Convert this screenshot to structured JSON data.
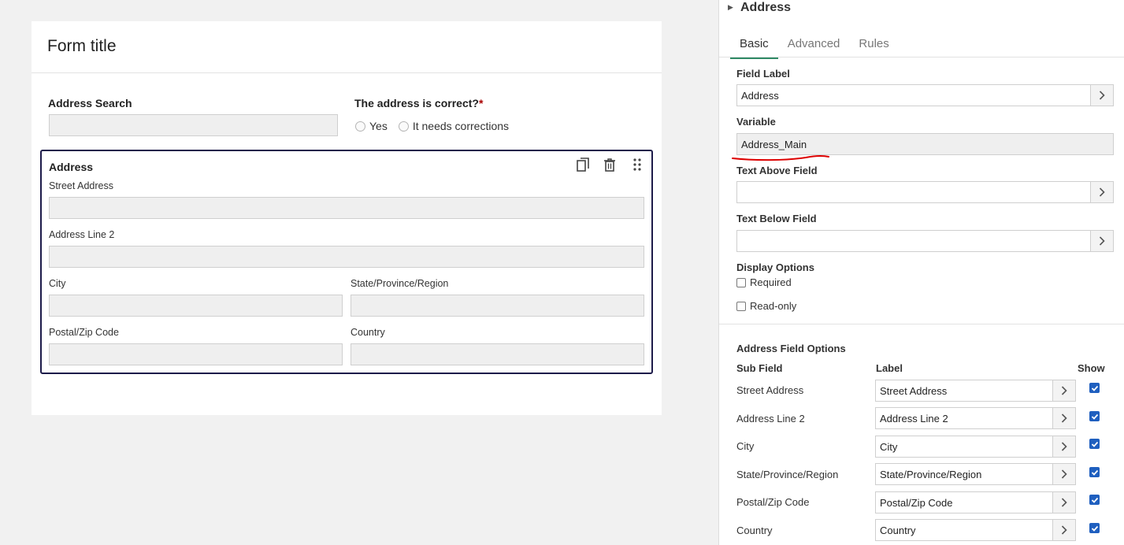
{
  "form": {
    "title": "Form title",
    "address_search_label": "Address Search",
    "correct_question": "The address is correct?",
    "required_marker": "*",
    "radio_yes": "Yes",
    "radio_corrections": "It needs corrections",
    "address_block": {
      "title": "Address",
      "street_label": "Street Address",
      "line2_label": "Address Line 2",
      "city_label": "City",
      "state_label": "State/Province/Region",
      "postal_label": "Postal/Zip Code",
      "country_label": "Country"
    }
  },
  "panel": {
    "title": "Address",
    "tabs": [
      {
        "label": "Basic",
        "active": true
      },
      {
        "label": "Advanced",
        "active": false
      },
      {
        "label": "Rules",
        "active": false
      }
    ],
    "field_label_title": "Field Label",
    "field_label_value": "Address",
    "variable_title": "Variable",
    "variable_value": "Address_Main",
    "text_above_title": "Text Above Field",
    "text_below_title": "Text Below Field",
    "display_options_title": "Display Options",
    "required_label": "Required",
    "readonly_label": "Read-only",
    "address_options_title": "Address Field Options",
    "col_subfield": "Sub Field",
    "col_label": "Label",
    "col_show": "Show",
    "subfields": [
      {
        "name": "Street Address",
        "label": "Street Address",
        "show": true
      },
      {
        "name": "Address Line 2",
        "label": "Address Line 2",
        "show": true
      },
      {
        "name": "City",
        "label": "City",
        "show": true
      },
      {
        "name": "State/Province/Region",
        "label": "State/Province/Region",
        "show": true
      },
      {
        "name": "Postal/Zip Code",
        "label": "Postal/Zip Code",
        "show": true
      },
      {
        "name": "Country",
        "label": "Country",
        "show": true
      }
    ]
  },
  "colors": {
    "accent_tab": "#2f8a66",
    "selected_border": "#1d1b4a",
    "checkbox_blue": "#1f5fbf",
    "annotation_red": "#dd0000"
  }
}
